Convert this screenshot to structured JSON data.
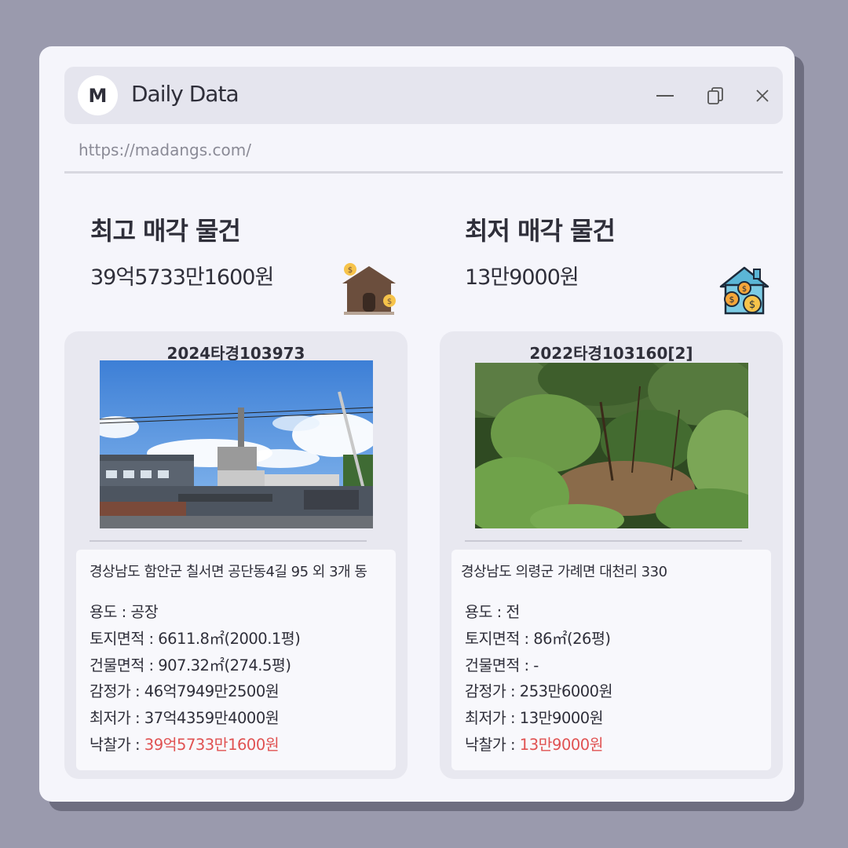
{
  "window": {
    "logo_letter": "M",
    "title": "Daily Data",
    "url": "https://madangs.com/",
    "controls": {
      "minimize": "—",
      "close": "✕"
    }
  },
  "highest": {
    "heading": "최고 매각 물건",
    "price": "39억5733만1600원",
    "case_no": "2024타경103973",
    "address": "경상남도 함안군 칠서면 공단동4길 95 외 3개 동",
    "details": {
      "usage": {
        "label": "용도 : ",
        "value": "공장"
      },
      "land_area": {
        "label": "토지면적 : ",
        "value": "6611.8㎡(2000.1평)"
      },
      "building_area": {
        "label": "건물면적 : ",
        "value": "907.32㎡(274.5평)"
      },
      "appraisal": {
        "label": "감정가 : ",
        "value": "46억7949만2500원"
      },
      "minimum": {
        "label": "최저가 : ",
        "value": "37억4359만4000원"
      },
      "winning_bid": {
        "label": "낙찰가 : ",
        "value": "39억5733만1600원"
      }
    }
  },
  "lowest": {
    "heading": "최저 매각 물건",
    "price": "13만9000원",
    "case_no": "2022타경103160[2]",
    "address": "경상남도 의령군 가례면 대천리 330",
    "details": {
      "usage": {
        "label": "용도 : ",
        "value": "전"
      },
      "land_area": {
        "label": "토지면적 : ",
        "value": "86㎡(26평)"
      },
      "building_area": {
        "label": "건물면적 : ",
        "value": "-"
      },
      "appraisal": {
        "label": "감정가 : ",
        "value": "253만6000원"
      },
      "minimum": {
        "label": "최저가 : ",
        "value": "13만9000원"
      },
      "winning_bid": {
        "label": "낙찰가 : ",
        "value": "13만9000원"
      }
    }
  },
  "colors": {
    "accent_red": "#e05252",
    "text": "#2f2f3a",
    "background": "#9a9aad"
  },
  "icons": [
    "house-coins-icon",
    "house-money-icon",
    "minimize-icon",
    "copy-icon",
    "close-icon"
  ]
}
